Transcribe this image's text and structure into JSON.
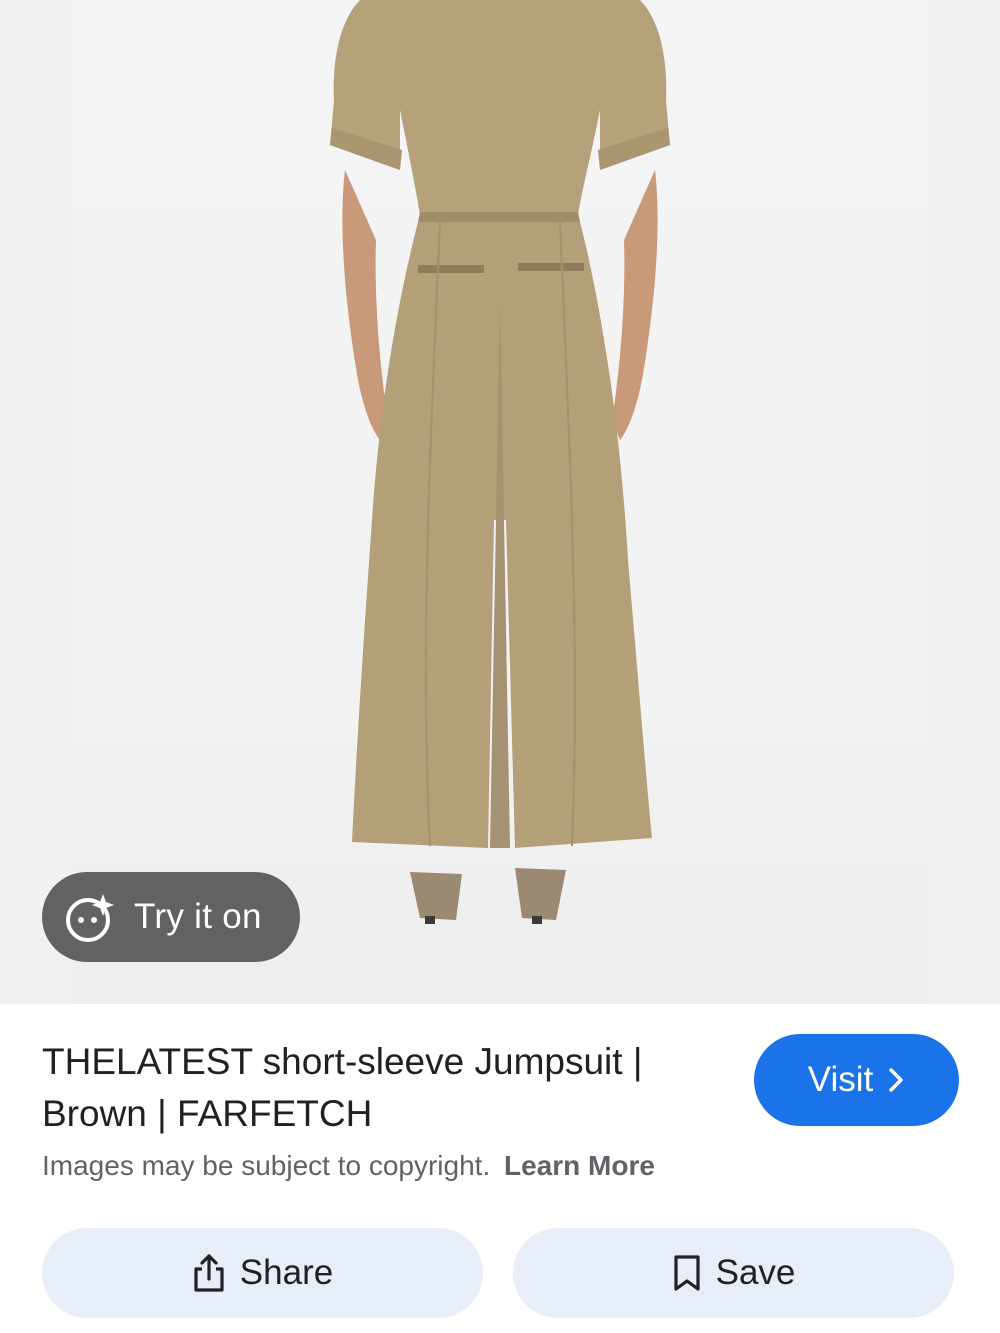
{
  "image": {
    "alt": "THELATEST short-sleeve Jumpsuit | Brown | FARFETCH",
    "garment_color": "#b5a27a",
    "try_on_label": "Try it on"
  },
  "result": {
    "title": "THELATEST short-sleeve Jumpsuit | Brown | FARFETCH",
    "visit_label": "Visit",
    "copyright_text": "Images may be subject to copyright.",
    "learn_more_label": "Learn More"
  },
  "actions": {
    "share_label": "Share",
    "save_label": "Save"
  },
  "colors": {
    "accent": "#1a73e8",
    "action_bg": "#e8eef8",
    "text_primary": "#202124",
    "text_secondary": "#5f6368"
  },
  "icons": {
    "try_on": "face-sparkle-icon",
    "visit": "chevron-right-icon",
    "share": "share-icon",
    "save": "bookmark-icon"
  }
}
